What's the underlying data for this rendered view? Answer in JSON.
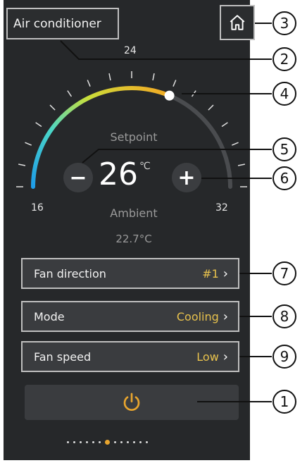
{
  "header": {
    "title": "Air conditioner",
    "home_icon": "home-icon"
  },
  "thermostat": {
    "setpoint_label": "Setpoint",
    "setpoint_value": "26",
    "unit": "℃",
    "min_label": "16",
    "mid_label": "24",
    "max_label": "32",
    "ambient_label": "Ambient",
    "ambient_value": "22.7°C",
    "minus_label": "−",
    "plus_label": "+"
  },
  "rows": [
    {
      "name": "Fan direction",
      "value": "#1"
    },
    {
      "name": "Mode",
      "value": "Cooling"
    },
    {
      "name": "Fan speed",
      "value": "Low"
    }
  ],
  "chevron": "›",
  "power": {
    "icon": "power-icon"
  },
  "pagination": {
    "total": 13,
    "active_index": 6
  },
  "callouts": [
    "1",
    "2",
    "3",
    "4",
    "5",
    "6",
    "7",
    "8",
    "9"
  ],
  "colors": {
    "accent": "#e8c24d",
    "background": "#26282a"
  }
}
